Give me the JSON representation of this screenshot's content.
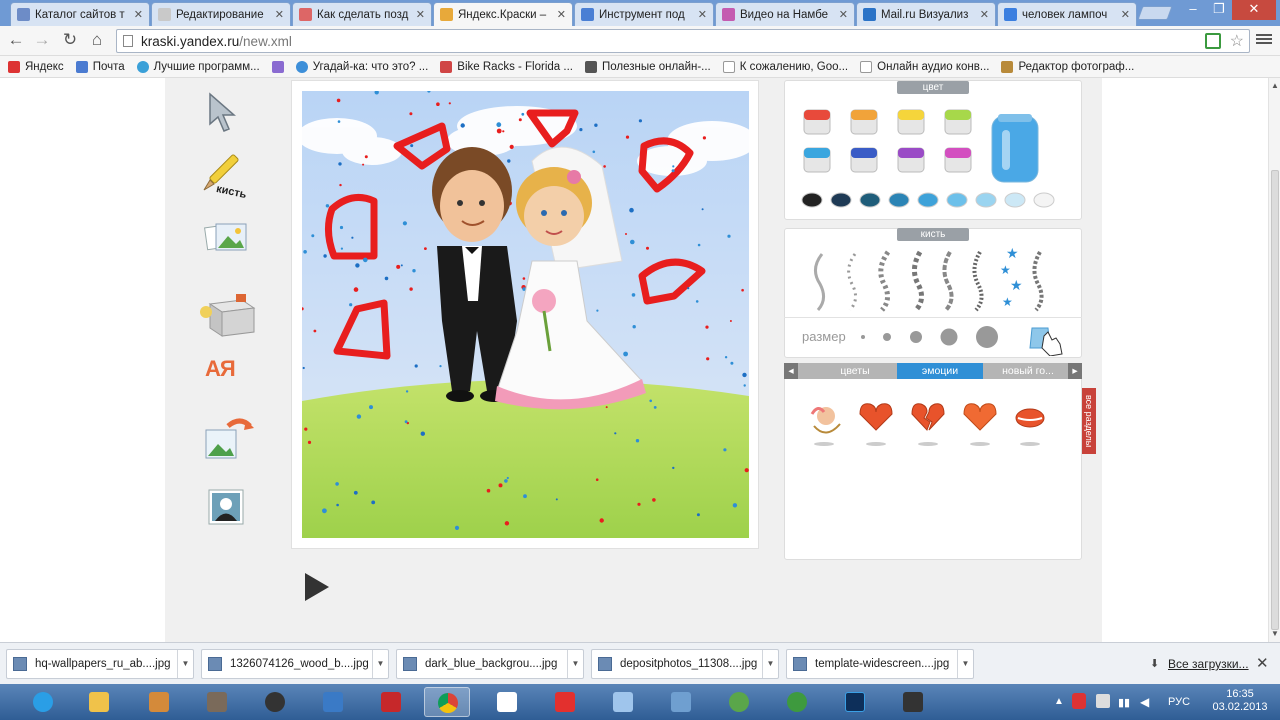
{
  "tabs": [
    {
      "title": "Каталог сайтов т",
      "color": "#6d8cc7"
    },
    {
      "title": "Редактирование",
      "color": "#c9c9c9"
    },
    {
      "title": "Как сделать позд",
      "color": "#d66"
    },
    {
      "title": "Яндекс.Краски –",
      "color": "#e8a93a"
    },
    {
      "title": "Инструмент под",
      "color": "#4a7fd4"
    },
    {
      "title": "Видео на Намбе",
      "color": "#c45bb0"
    },
    {
      "title": "Mail.ru Визуализ",
      "color": "#2b73c7"
    },
    {
      "title": "человек лампоч",
      "color": "#3b7fe0"
    }
  ],
  "window_controls": {
    "minimize": "–",
    "maximize": "❐",
    "close": "✕"
  },
  "nav": {
    "back": "←",
    "forward": "→",
    "reload": "↻",
    "home": "⌂"
  },
  "omnibox": {
    "host": "kraski.yandex.ru",
    "path": "/new.xml",
    "star": "☆"
  },
  "bookmarks": [
    {
      "label": "Яндекс",
      "color": "#d33"
    },
    {
      "label": "Почта",
      "color": "#4b7bd1"
    },
    {
      "label": "Лучшие программ...",
      "color": "#3aa0d8"
    },
    {
      "label": "",
      "color": "#8a6bd1"
    },
    {
      "label": "Угадай-ка: что это? ...",
      "color": "#3d8fd9"
    },
    {
      "label": "Bike Racks - Florida ...",
      "color": "#d04545"
    },
    {
      "label": "Полезные онлайн-...",
      "color": "#555"
    },
    {
      "label": "К сожалению, Goo...",
      "color": "#ddd"
    },
    {
      "label": "Онлайн аудио конв...",
      "color": "#ddd"
    },
    {
      "label": "Редактор фотограф...",
      "color": "#b88a3a"
    }
  ],
  "tools": {
    "brush_label": "кисть",
    "text_tool": "АЯ"
  },
  "palette": {
    "title": "цвет",
    "buckets": [
      "#e84a3b",
      "#f1a33a",
      "#f5d53b",
      "#a7d84a",
      "#3aa6df",
      "#3a5cc6",
      "#9a4bc6",
      "#d34fc0"
    ],
    "selected_color": "#4aa8e6",
    "drops": [
      "#222222",
      "#1e3a55",
      "#1f5d7a",
      "#2b84b5",
      "#3ea2d9",
      "#6cc0ea",
      "#9ad4f0",
      "#cce8f6",
      "#f4f4f4"
    ]
  },
  "brush": {
    "title": "кисть",
    "size_label": "размер"
  },
  "stamps": {
    "tabs": [
      "цветы",
      "эмоции",
      "новый го..."
    ],
    "active_tab": "эмоции",
    "side_label": "все разделы"
  },
  "downloads": [
    {
      "name": "hq-wallpapers_ru_ab....jpg"
    },
    {
      "name": "1326074126_wood_b....jpg"
    },
    {
      "name": "dark_blue_backgrou....jpg"
    },
    {
      "name": "depositphotos_11308....jpg"
    },
    {
      "name": "template-widescreen....jpg"
    }
  ],
  "downloads_all": "Все загрузки...",
  "taskbar": {
    "lang": "РУС",
    "time": "16:35",
    "date": "03.02.2013"
  }
}
